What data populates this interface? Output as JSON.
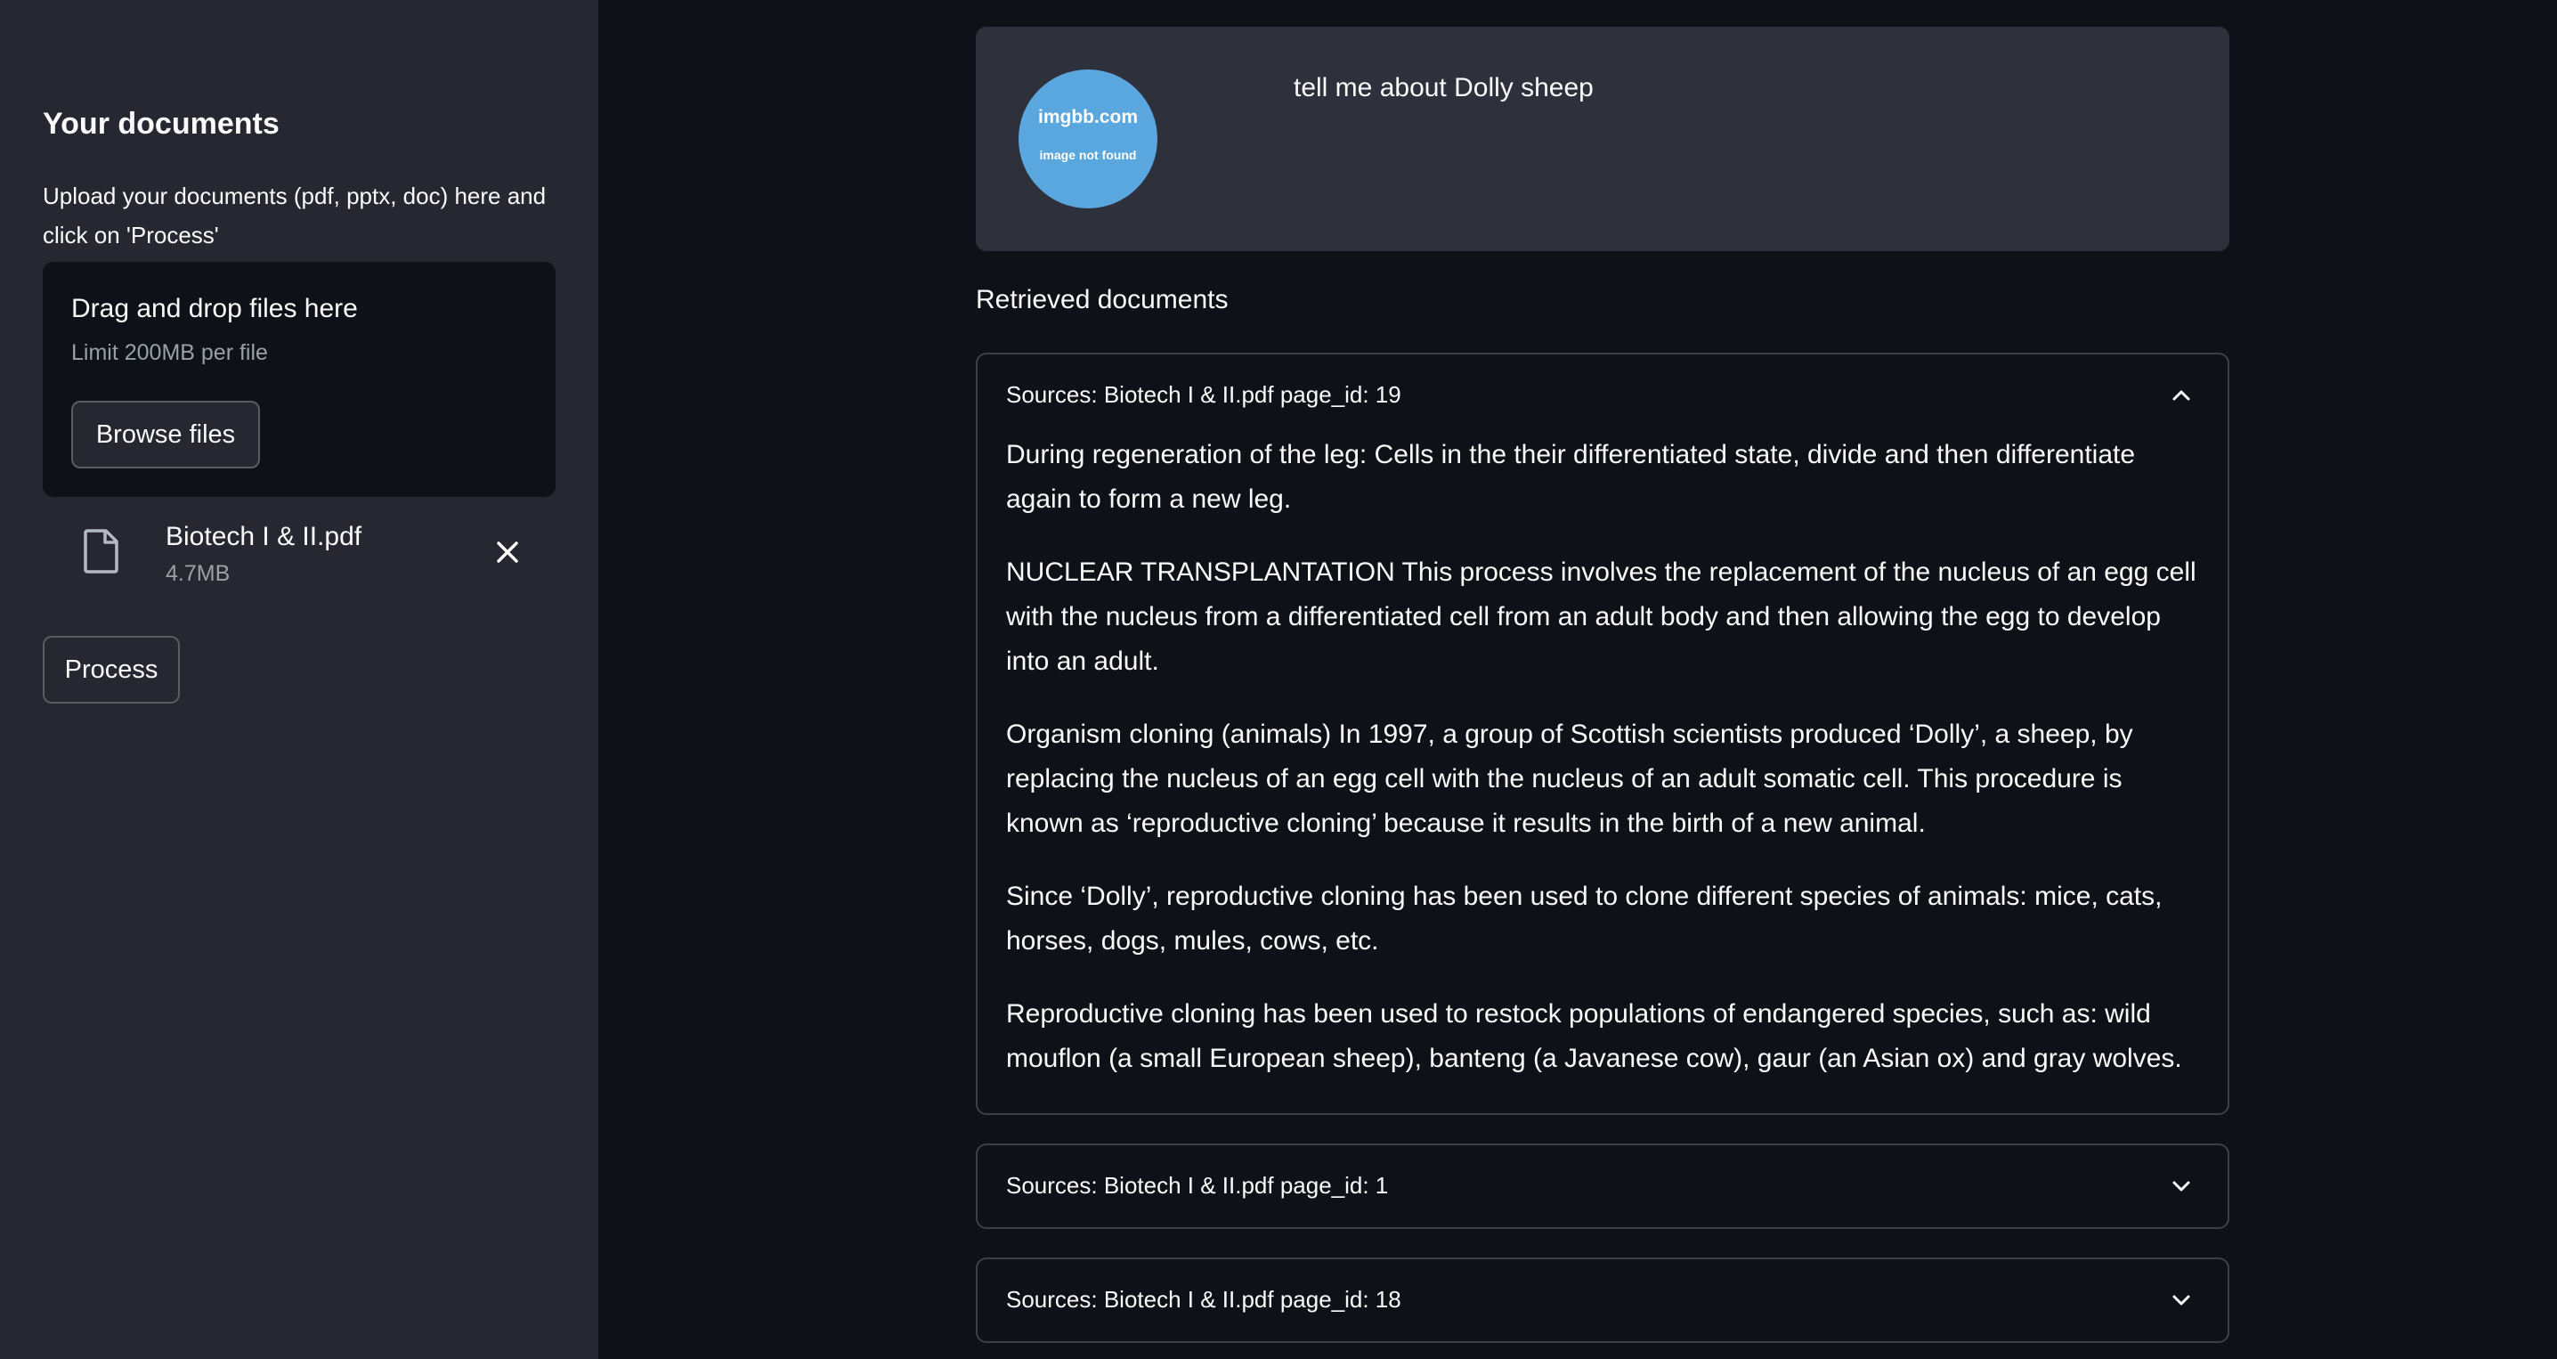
{
  "sidebar": {
    "title": "Your documents",
    "description": "Upload your documents (pdf, pptx, doc) here and click on 'Process'",
    "dropzone": {
      "title": "Drag and drop files here",
      "limit": "Limit 200MB per file",
      "browse_label": "Browse files"
    },
    "file": {
      "name": "Biotech I & II.pdf",
      "size": "4.7MB",
      "icon": "file-icon"
    },
    "process_label": "Process"
  },
  "chat": {
    "avatar": {
      "brand": "imgbb.com",
      "message": "image not found"
    },
    "message": "tell me about Dolly sheep"
  },
  "retrieved": {
    "heading": "Retrieved documents",
    "expanders": [
      {
        "label": "Sources: Biotech I & II.pdf page_id: 19",
        "expanded": true,
        "paragraphs": [
          "During regeneration of the leg: Cells in the their differentiated state, divide and then differentiate again to form a new leg.",
          "NUCLEAR TRANSPLANTATION This process involves the replacement of the nucleus of an egg cell with the nucleus from a differentiated cell from an adult body and then allowing the egg to develop into an adult.",
          "Organism cloning (animals) In 1997, a group of Scottish scientists produced ‘Dolly’, a sheep, by replacing the nucleus of an egg cell with the nucleus of an adult somatic cell. This procedure is known as ‘reproductive cloning’ because it results in the birth of a new animal.",
          "Since ‘Dolly’, reproductive cloning has been used to clone different species of animals: mice, cats, horses, dogs, mules, cows, etc.",
          "Reproductive cloning has been used to restock populations of endangered species, such as: wild mouflon (a small European sheep), banteng (a Javanese cow), gaur (an Asian ox) and gray wolves."
        ]
      },
      {
        "label": "Sources: Biotech I & II.pdf page_id: 1",
        "expanded": false
      },
      {
        "label": "Sources: Biotech I & II.pdf page_id: 18",
        "expanded": false
      }
    ]
  },
  "colors": {
    "app_background": "#0e1117",
    "sidebar_background": "#262730",
    "chat_card_background": "#2e313c",
    "avatar_background": "#5aa6de",
    "text": "#fafafa",
    "muted_text": "#9aa0a6"
  }
}
